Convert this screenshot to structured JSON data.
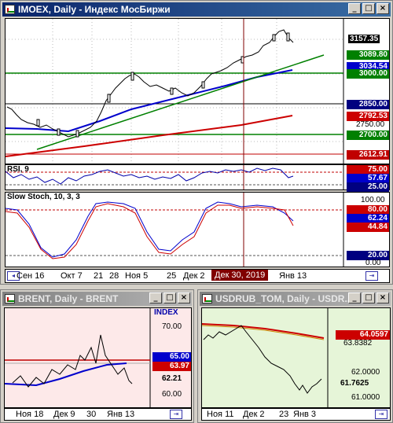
{
  "windows": {
    "main": {
      "title": "IMOEX, Daily - Индекс МосБиржи",
      "price_labels": [
        "3157.35",
        "3089.80",
        "3034.54",
        "3000.00",
        "2850.00",
        "2792.53",
        "2750.00",
        "2700.00",
        "2612.91"
      ],
      "rsi_title": "RSI, 9",
      "rsi_labels": [
        "75.00",
        "57.67",
        "25.00"
      ],
      "stoch_title": "Slow Stoch, 10, 3, 3",
      "stoch_labels": [
        "100.00",
        "80.00",
        "62.24",
        "44.84",
        "20.00",
        "0.00"
      ],
      "x_labels": [
        "Сен 16",
        "Окт 7",
        "21",
        "28",
        "Ноя 5",
        "25",
        "Дек 2",
        "Янв 13"
      ],
      "crosshair_date": "Дек 30, 2019",
      "colors": {
        "accent": "#0a246a",
        "price_line": "#c00000",
        "ma_blue": "#0000cc",
        "ma_red": "#cc0000",
        "trend_green": "#008000"
      }
    },
    "brent": {
      "title": "BRENT, Daily - BRENT",
      "index_label": "INDEX",
      "price_labels": [
        "70.00",
        "65.00",
        "63.97",
        "62.21",
        "60.00"
      ],
      "x_labels": [
        "Ноя 18",
        "Дек 9",
        "30",
        "Янв 13"
      ]
    },
    "usdrub": {
      "title": "USDRUB_TOM, Daily - USDR...",
      "price_labels": [
        "64.0597",
        "63.8382",
        "62.0000",
        "61.7625",
        "61.0000"
      ],
      "x_labels": [
        "Ноя 11",
        "Дек 2",
        "23",
        "Янв 3"
      ]
    }
  }
}
